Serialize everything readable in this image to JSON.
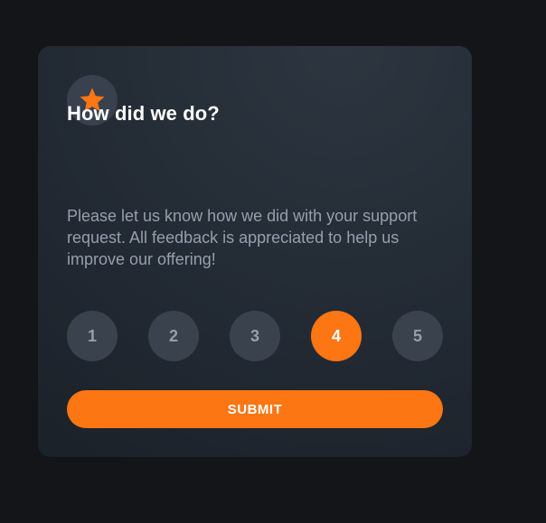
{
  "card": {
    "title": "How did we do?",
    "description": "Please let us know how we did with your support request. All feedback is appreciated to help us improve our offering!",
    "icon": "star-icon",
    "ratings": [
      "1",
      "2",
      "3",
      "4",
      "5"
    ],
    "selected_rating": "4",
    "submit_label": "SUBMIT"
  },
  "colors": {
    "accent": "#fc7614",
    "card_background": "#252d37",
    "page_background": "#131518",
    "rating_background": "#3a424d",
    "muted_text": "#969fad"
  }
}
